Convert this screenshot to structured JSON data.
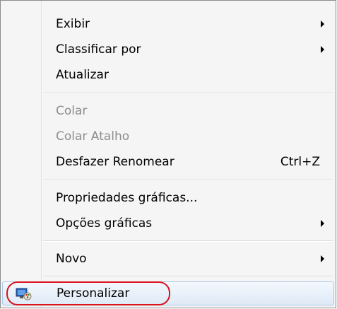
{
  "context_menu": {
    "items": [
      {
        "label": "Exibir"
      },
      {
        "label": "Classificar por"
      },
      {
        "label": "Atualizar"
      },
      {
        "label": "Colar"
      },
      {
        "label": "Colar Atalho"
      },
      {
        "label": "Desfazer Renomear",
        "shortcut": "Ctrl+Z"
      },
      {
        "label": "Propriedades gráficas..."
      },
      {
        "label": "Opções gráficas"
      },
      {
        "label": "Novo"
      },
      {
        "label": "Personalizar",
        "icon": "personalize-icon"
      }
    ]
  },
  "colors": {
    "highlight_ring": "#d8151f",
    "disabled_text": "#8d8d8d"
  }
}
